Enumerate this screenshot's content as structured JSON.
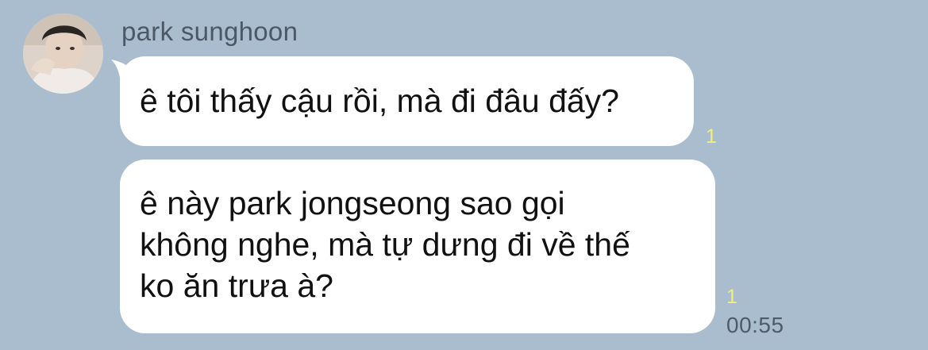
{
  "sender": {
    "name": "park sunghoon"
  },
  "messages": [
    {
      "text": "ê tôi thấy cậu rồi, mà đi đâu đấy?",
      "read_count": "1"
    },
    {
      "lines": [
        "ê này park jongseong sao gọi",
        "không nghe, mà tự dưng đi về thế",
        "ko ăn trưa à?"
      ],
      "read_count": "1",
      "time": "00:55"
    }
  ],
  "colors": {
    "background": "#a9bdcf",
    "bubble": "#ffffff",
    "read_count": "#f3ee75",
    "sender_name": "#4b5866",
    "timestamp": "#4e5b69"
  }
}
